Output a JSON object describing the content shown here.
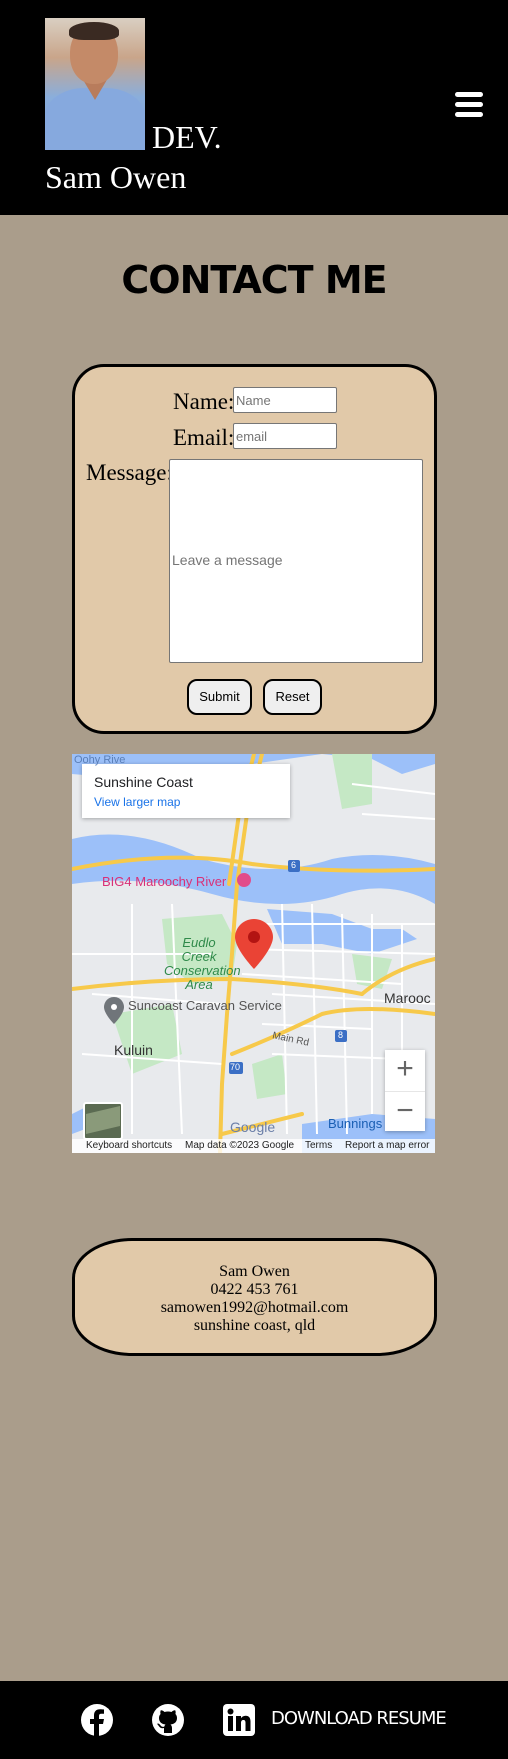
{
  "header": {
    "dev_label": "DEV.",
    "name": "Sam Owen",
    "menu_icon": "hamburger-menu-icon"
  },
  "page_title": "CONTACT ME",
  "form": {
    "name_label": "Name:",
    "name_placeholder": "Name",
    "email_label": "Email:",
    "email_placeholder": "email",
    "message_label": "Message:",
    "message_placeholder": "Leave a message",
    "submit_label": "Submit",
    "reset_label": "Reset"
  },
  "map": {
    "place_title": "Sunshine Coast",
    "larger_map_link": "View larger map",
    "labels": {
      "big4": "BIG4 Maroochy River",
      "eudlo": "Eudlo Creek Conservation Area",
      "suncoast": "Suncoast Caravan Service",
      "kuluin": "Kuluin",
      "maroochydore": "Marooc",
      "main_rd": "Main Rd",
      "bunnings": "Bunnings",
      "road_6": "6",
      "road_8": "8",
      "road_70": "70",
      "cut_label": "Oohy Rive"
    },
    "logo": "Google",
    "zoom_in": "+",
    "zoom_out": "−",
    "footer": {
      "shortcuts": "Keyboard shortcuts",
      "map_data": "Map data ©2023 Google",
      "terms": "Terms",
      "report": "Report a map error"
    }
  },
  "contact_info": {
    "name": "Sam Owen",
    "phone": "0422 453 761",
    "email": "samowen1992@hotmail.com",
    "location": "sunshine coast, qld"
  },
  "footer": {
    "icons": [
      "facebook-icon",
      "github-icon",
      "linkedin-icon"
    ],
    "resume_label": "DOWNLOAD RESUME"
  },
  "colors": {
    "page_bg": "#aa9d8b",
    "card_bg": "#e1c9a9",
    "header_bg": "#000000"
  }
}
